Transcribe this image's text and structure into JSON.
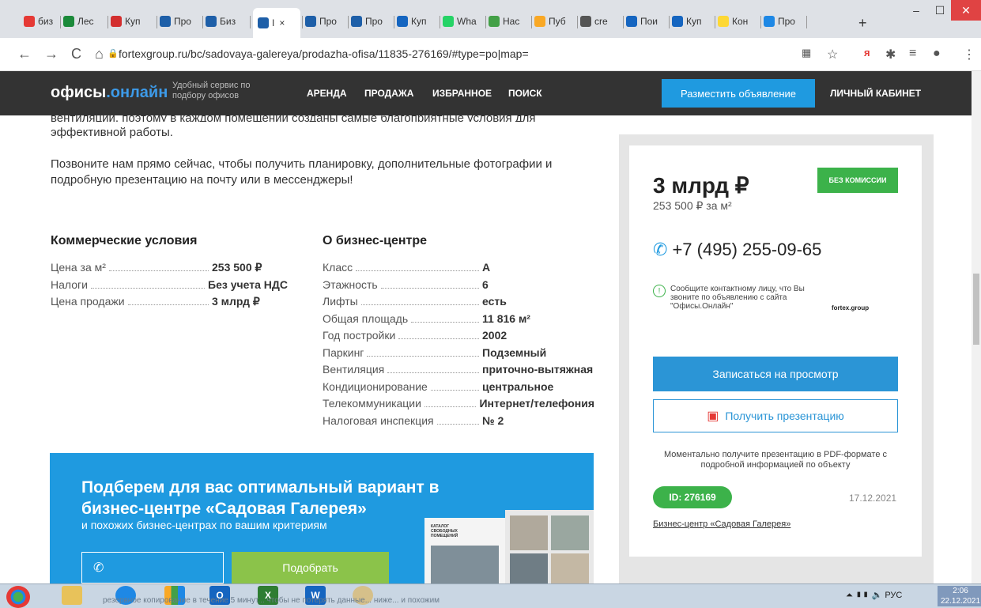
{
  "browser": {
    "tabs": [
      {
        "label": "биз",
        "color": "#e53935"
      },
      {
        "label": "Лес",
        "color": "#1b8a3a"
      },
      {
        "label": "Куп",
        "color": "#d32f2f"
      },
      {
        "label": "Про",
        "color": "#1e5fa8"
      },
      {
        "label": "Биз",
        "color": "#1e5fa8"
      },
      {
        "label": "I",
        "color": "#1e5fa8"
      },
      {
        "label": "Про",
        "color": "#1e5fa8"
      },
      {
        "label": "Про",
        "color": "#1e5fa8"
      },
      {
        "label": "Куп",
        "color": "#1565c0"
      },
      {
        "label": "Wha",
        "color": "#25d366"
      },
      {
        "label": "Нас",
        "color": "#43a047"
      },
      {
        "label": "Пуб",
        "color": "#f9a825"
      },
      {
        "label": "cre",
        "color": "#555555"
      },
      {
        "label": "Пои",
        "color": "#1565c0"
      },
      {
        "label": "Куп",
        "color": "#1565c0"
      },
      {
        "label": "Кон",
        "color": "#fdd835"
      },
      {
        "label": "Про",
        "color": "#1e88e5"
      }
    ],
    "tab_close": "×",
    "new_tab": "+",
    "url": "fortexgroup.ru/bc/sadovaya-galereya/prodazha-ofisa/11835-276169/#type=po|map="
  },
  "site": {
    "logo_main": "офисы",
    "logo_accent": ".онлайн",
    "tagline": "Удобный сервис по подбору офисов",
    "nav": [
      "АРЕНДА",
      "ПРОДАЖА",
      "ИЗБРАННОЕ",
      "ПОИСК"
    ],
    "post_button": "Разместить объявление",
    "cabinet": "ЛИЧНЫЙ КАБИНЕТ"
  },
  "content": {
    "para_partial": "вентиляции, поэтому в каждом помещении созданы самые благоприятные условия для",
    "para1_end": "эффективной работы.",
    "para2": "Позвоните нам прямо сейчас, чтобы получить планировку, дополнительные фотографии и подробную презентацию на почту или в мессенджеры!",
    "commercial": {
      "title": "Коммерческие условия",
      "rows": [
        {
          "k": "Цена за м²",
          "v": "253 500 ₽"
        },
        {
          "k": "Налоги",
          "v": "Без учета НДС"
        },
        {
          "k": "Цена продажи",
          "v": "3 млрд ₽"
        }
      ]
    },
    "business_center": {
      "title": "О бизнес-центре",
      "rows": [
        {
          "k": "Класс",
          "v": "A"
        },
        {
          "k": "Этажность",
          "v": "6"
        },
        {
          "k": "Лифты",
          "v": "есть"
        },
        {
          "k": "Общая площадь",
          "v": "11 816 м²"
        },
        {
          "k": "Год постройки",
          "v": "2002"
        },
        {
          "k": "Паркинг",
          "v": "Подземный"
        },
        {
          "k": "Вентиляция",
          "v": "приточно-вытяжная"
        },
        {
          "k": "Кондиционирование",
          "v": "центральное"
        },
        {
          "k": "Телекоммуникации",
          "v": "Интернет/телефония"
        },
        {
          "k": "Налоговая инспекция",
          "v": "№ 2"
        }
      ]
    }
  },
  "card": {
    "price": "3 млрд ₽",
    "price_per_m2": "253 500 ₽ за м²",
    "no_fee": "БЕЗ КОМИССИИ",
    "phone": "+7 (495) 255-09-65",
    "notice": "Сообщите контактному лицу, что Вы звоните по объявлению с сайта \"Офисы.Онлайн\"",
    "agency": "fortex.group",
    "view_button": "Записаться на просмотр",
    "presentation_button": "Получить презентацию",
    "presentation_note": "Моментально получите презентацию в PDF-формате с подробной информацией по объекту",
    "id_badge": "ID: 276169",
    "date": "17.12.2021",
    "bc_link": "Бизнес-центр «Садовая Галерея»"
  },
  "promo": {
    "title": "Подберем для вас оптимальный вариант в бизнес-центре «Садовая Галерея»",
    "subtitle": "и похожих бизнес-центрах по вашим критериям",
    "button": "Подобрать",
    "catalog_label": "КАТАЛОГ СВОБОДНЫХ ПОМЕЩЕНИЙ"
  },
  "taskbar": {
    "ghost_text": "резервное копирование в течение 5 минут... чтобы не потерять данные... ниже... и похожим",
    "lang": "РУС",
    "time": "2:06",
    "date": "22.12.2021"
  },
  "icons": [
    "back-icon",
    "forward-icon",
    "reload-icon",
    "home-icon",
    "lock-icon",
    "star-icon",
    "extensions-icon",
    "profile-icon",
    "menu-icon",
    "phone-icon",
    "info-icon",
    "pdf-icon"
  ]
}
